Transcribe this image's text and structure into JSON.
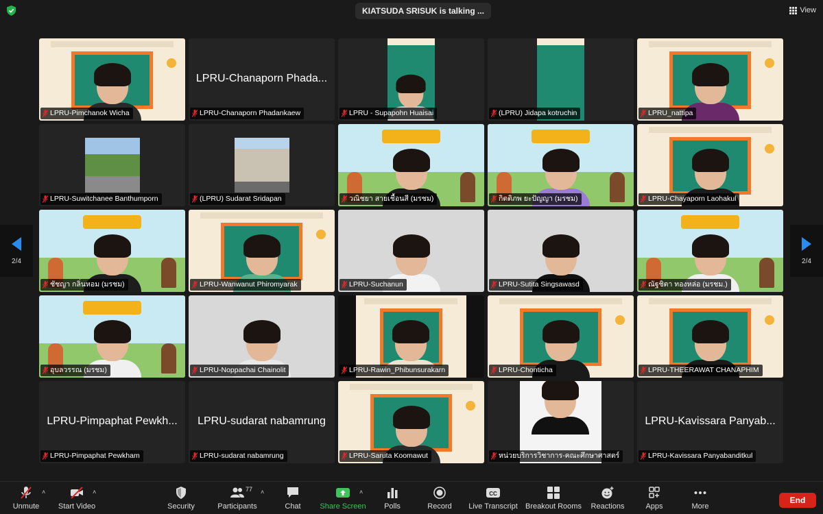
{
  "meeting": {
    "talking_banner": "KIATSUDA SRISUK is talking ...",
    "view_label": "View"
  },
  "pager": {
    "left": "2/4",
    "right": "2/4"
  },
  "participants": [
    {
      "name": "LPRU-Pimchanok Wicha",
      "video": "board",
      "shirt": "#2a2a2a"
    },
    {
      "name": "LPRU-Chanaporn Phadankaew",
      "big_name": "LPRU-Chanaporn Phada...",
      "video": "none"
    },
    {
      "name": "LPRU - Supapohn Huaisai",
      "video": "green",
      "shirt": "#d9d9d9"
    },
    {
      "name": "(LPRU) Jidapa kotruchin",
      "video": "green-empty"
    },
    {
      "name": "LPRU_nattipa",
      "video": "board",
      "shirt": "#6a2a6a"
    },
    {
      "name": "LPRU-Suwitchanee Banthumporn",
      "video": "thumb-road"
    },
    {
      "name": "(LPRU) Sudarat Sridapan",
      "video": "thumb-building"
    },
    {
      "name": "วณิชยา สายเชื้อนสี (มรชม)",
      "video": "cartoon",
      "shirt": "#1b1b1b"
    },
    {
      "name": "กิตติภพ ยะปัญญา (มรชม)",
      "video": "cartoon",
      "shirt": "#9a7bd6"
    },
    {
      "name": "LPRU-Chayaporn Laohakul",
      "video": "board",
      "shirt": "#1c1c1c"
    },
    {
      "name": "ชัชญา กลิ่นหอม (มรชม)",
      "video": "cartoon",
      "shirt": "#1d1d1d"
    },
    {
      "name": "LPRU-Wanwanut Phiromyarak",
      "video": "board",
      "shirt": "#5ab08a"
    },
    {
      "name": "LPRU-Suchanun",
      "video": "plain",
      "shirt": "#f2f2f2"
    },
    {
      "name": "LPRU-Sutita Singsawasd",
      "video": "plain",
      "shirt": "#111111"
    },
    {
      "name": "ณัฐชิตา ทองหล่อ (มรชม.)",
      "video": "cartoon",
      "shirt": "#f0f0f0"
    },
    {
      "name": "อุบลวรรณ (มรชม)",
      "video": "cartoon",
      "shirt": "#f0f0f0"
    },
    {
      "name": "LPRU-Noppachai Chainolit",
      "video": "plain",
      "shirt": "#e9e9e9"
    },
    {
      "name": "LPRU-Rawin_Phibunsurakarn",
      "video": "board-small",
      "shirt": "#ece3cf"
    },
    {
      "name": "LPRU-Chonticha",
      "video": "board",
      "shirt": "#1a1a1a"
    },
    {
      "name": "LPRU-THEERAWAT CHANAPHIM",
      "video": "board",
      "shirt": "#1a1a1a"
    },
    {
      "name": "LPRU-Pimpaphat Pewkham",
      "big_name": "LPRU-Pimpaphat Pewkh...",
      "video": "none"
    },
    {
      "name": "LPRU-sudarat nabamrung",
      "big_name": "LPRU-sudarat nabamrung",
      "video": "none"
    },
    {
      "name": "LPRU-Saruta Koomawut",
      "video": "board",
      "shirt": "#2a2a2a"
    },
    {
      "name": "หน่วยบริการวิชาการ-คณะศึกษาศาสตร์",
      "video": "portrait",
      "shirt": "#111111"
    },
    {
      "name": "LPRU-Kavissara Panyabanditkul",
      "big_name": "LPRU-Kavissara Panyab...",
      "video": "none"
    }
  ],
  "toolbar": {
    "unmute": "Unmute",
    "start_video": "Start Video",
    "security": "Security",
    "participants": "Participants",
    "participants_count": "77",
    "chat": "Chat",
    "share_screen": "Share Screen",
    "polls": "Polls",
    "record": "Record",
    "live_transcript": "Live Transcript",
    "breakout_rooms": "Breakout Rooms",
    "reactions": "Reactions",
    "apps": "Apps",
    "more": "More",
    "end": "End"
  },
  "colors": {
    "accent_green": "#3fc35b",
    "end_red": "#d8231b",
    "pager_blue": "#2a8cf0",
    "muted_red": "#e0282a"
  }
}
